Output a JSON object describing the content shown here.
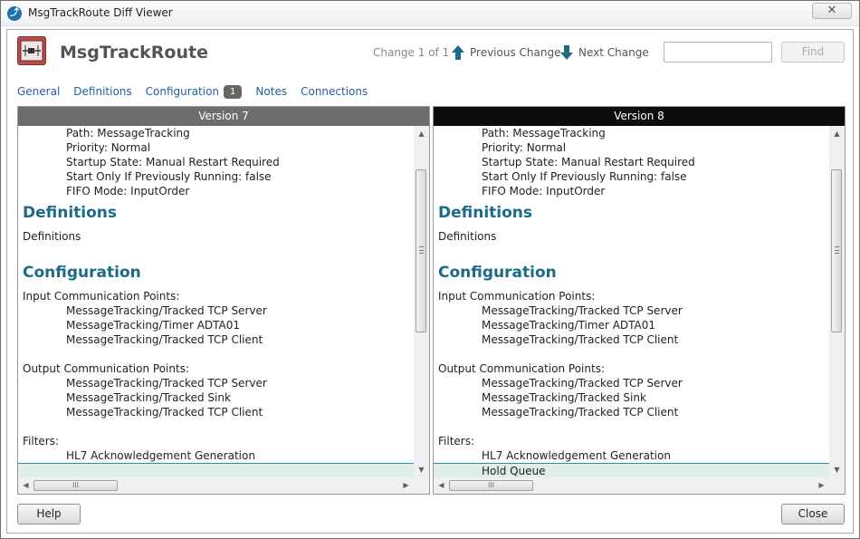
{
  "window": {
    "title": "MsgTrackRoute Diff Viewer",
    "close_symbol": "✕"
  },
  "header": {
    "route_name": "MsgTrackRoute",
    "change_status": "Change 1 of 1",
    "previous_label": "Previous Change",
    "next_label": "Next Change",
    "find_value": "",
    "find_placeholder": "",
    "find_label": "Find"
  },
  "tabs": [
    {
      "label": "General"
    },
    {
      "label": "Definitions"
    },
    {
      "label": "Configuration",
      "badge": "1"
    },
    {
      "label": "Notes"
    },
    {
      "label": "Connections"
    }
  ],
  "panes": {
    "left": {
      "header": "Version 7",
      "lines": [
        "Path: MessageTracking",
        "Priority: Normal",
        "Startup State: Manual Restart Required",
        "Start Only If Previously Running: false",
        "FIFO Mode: InputOrder"
      ],
      "definitions_heading": "Definitions",
      "definitions_text": "Definitions",
      "configuration_heading": "Configuration",
      "input_label": "Input Communication Points:",
      "input_items": [
        "MessageTracking/Tracked TCP Server",
        "MessageTracking/Timer ADTA01",
        "MessageTracking/Tracked TCP Client"
      ],
      "output_label": "Output Communication Points:",
      "output_items": [
        "MessageTracking/Tracked TCP Server",
        "MessageTracking/Tracked Sink",
        "MessageTracking/Tracked TCP Client"
      ],
      "filters_label": "Filters:",
      "filter_items": [
        "HL7 Acknowledgement Generation"
      ],
      "highlight_text": ""
    },
    "right": {
      "header": "Version 8",
      "lines": [
        "Path: MessageTracking",
        "Priority: Normal",
        "Startup State: Manual Restart Required",
        "Start Only If Previously Running: false",
        "FIFO Mode: InputOrder"
      ],
      "definitions_heading": "Definitions",
      "definitions_text": "Definitions",
      "configuration_heading": "Configuration",
      "input_label": "Input Communication Points:",
      "input_items": [
        "MessageTracking/Tracked TCP Server",
        "MessageTracking/Timer ADTA01",
        "MessageTracking/Tracked TCP Client"
      ],
      "output_label": "Output Communication Points:",
      "output_items": [
        "MessageTracking/Tracked TCP Server",
        "MessageTracking/Tracked Sink",
        "MessageTracking/Tracked TCP Client"
      ],
      "filters_label": "Filters:",
      "filter_items": [
        "HL7 Acknowledgement Generation"
      ],
      "highlight_text": "Hold Queue"
    }
  },
  "footer": {
    "help_label": "Help",
    "close_label": "Close"
  },
  "colors": {
    "heading": "#1b6b87",
    "link": "#1f5fa0",
    "arrow": "#1b6b87",
    "left_header_bg": "#6d6d6d",
    "right_header_bg": "#0d0d0d",
    "diff_highlight": "#dfeee6"
  }
}
